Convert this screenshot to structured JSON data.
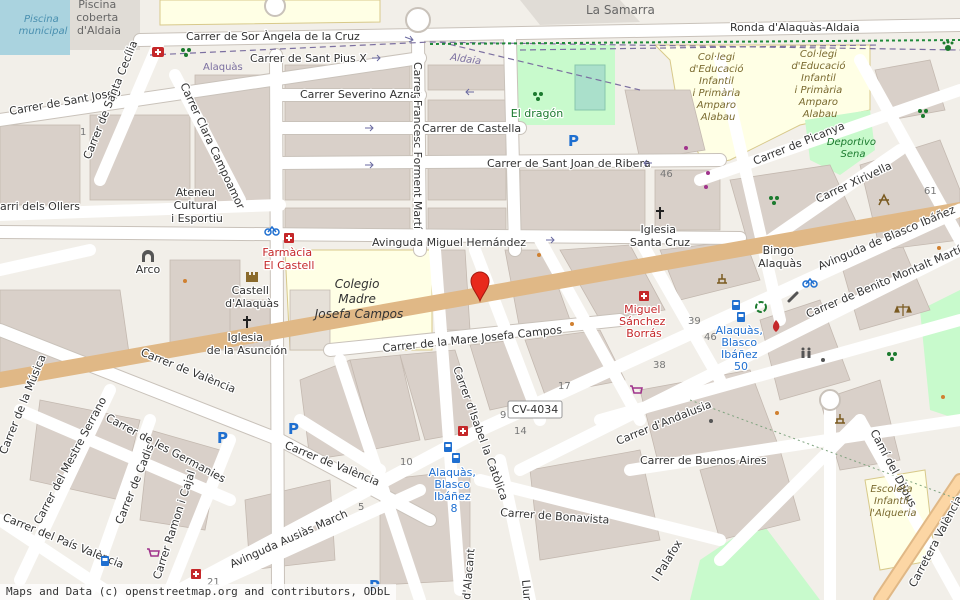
{
  "map": {
    "streets": {
      "sor_angela": "Carrer de Sor Àngela de la Cruz",
      "ronda": "Ronda d'Alaquàs-Aldaia",
      "sant_pius": "Carrer de Sant Pius X",
      "sant_josep": "Carrer de Sant Josep",
      "santa_cecilia": "Carrer de Santa Cecília",
      "clara_campoamor": "Carrer Clara Campoamor",
      "severino": "Carrer Severino Aznar",
      "castella": "Carrer de Castella",
      "francesc": "Carrer Francesc Forment Martí",
      "sant_joan": "Carrer de Sant Joan de Ribera",
      "miguel_hernandez": "Avinguda Miguel Hernández",
      "picanya": "Carrer de Picanya",
      "xirivella": "Carrer Xirivella",
      "blasco": "Avinguda de Blasco Ibáñez",
      "benito": "Carrer de Benito Montalt Martínez",
      "mare_josefa": "Carrer de la Mare Josefa Campos",
      "valencia_1": "Carrer de València",
      "valencia_2": "Carrer de València",
      "isabel": "Carrer d'Isabel la Catòlica",
      "musica": "Carrer de la Música",
      "mestre_serrano": "Carrer del Mestre Serrano",
      "germanies": "Carrer de les Germanies",
      "cadis": "Carrer de Cadis",
      "pais_valencia": "Carrer del País València",
      "ramon": "Carrer Ramon i Cajal",
      "ausias": "Avinguda Ausiàs March",
      "bonavista": "Carrer de Bonavista",
      "andalusia": "Carrer d'Andalusia",
      "buenos_aires": "Carrer de Buenos Aires",
      "cami_dijous": "Camí del Dijous",
      "carretera": "Carretera València",
      "alacant": "d'Alacant",
      "lluna": "Lluna",
      "palafox": "l Palafox",
      "ollers": "arri dels Ollers",
      "la_samarra": "La Samarra",
      "alaquas_small": "Alaquàs",
      "aldaia_small": "Aldaia"
    },
    "road_ref": "CV-4034",
    "places": {
      "piscina_municipal": [
        "Piscina",
        "municipal"
      ],
      "piscina_coberta": [
        "Piscina",
        "coberta",
        "d'Aldaia"
      ],
      "el_dragon": "El dragón",
      "colegio_educacio_1": [
        "Col·legi",
        "d'Educació",
        "Infantil",
        "i Primària",
        "Amparo",
        "Alabau"
      ],
      "colegio_educacio_2": [
        "Col·legi",
        "d'Educació",
        "Infantil",
        "i Primària",
        "Amparo",
        "Alabau"
      ],
      "deportivo_sena": [
        "Deportivo",
        "Sena"
      ],
      "ateneu": [
        "Ateneu",
        "Cultural",
        "i Esportiu"
      ],
      "farmacia_castell": [
        "Farmàcia",
        "El Castell"
      ],
      "colegio_madre": [
        "Colegio",
        "Madre",
        "Josefa Campos"
      ],
      "iglesia_santa_cruz": [
        "Iglesia",
        "Santa Cruz"
      ],
      "bingo": [
        "Bingo",
        "Alaquàs"
      ],
      "arco": "Arco",
      "castell": [
        "Castell",
        "d'Alaquàs"
      ],
      "iglesia_asuncion": [
        "Iglesia",
        "de la Asunción"
      ],
      "miguel_sanchez": [
        "Miguel",
        "Sánchez",
        "Borrás"
      ],
      "bus_50": [
        "Alaquàs,",
        "Blasco",
        "Ibáñez",
        "50"
      ],
      "bus_8": [
        "Alaquàs,",
        "Blasco",
        "Ibáñez",
        "8"
      ],
      "escoleta": [
        "Escoleta",
        "Infantil",
        "l'Alqueria"
      ]
    },
    "house_numbers": [
      "46",
      "61",
      "39",
      "46",
      "38",
      "17",
      "9",
      "14",
      "10",
      "5",
      "1",
      "21"
    ],
    "colors": {
      "background": "#f2efe9",
      "building": "#d9d0c9",
      "road": "#ffffff",
      "road_casing": "#c9c2ba",
      "primary_road": "#fcd6a4",
      "park": "#c8facc",
      "school": "#ffffe5",
      "pitch": "#aae0cb",
      "water": "#aad3df",
      "pharmacy_red": "#c5282a",
      "bus_blue": "#1f6fd0",
      "marker_red": "#e8291c"
    },
    "attribution": "Maps and Data (c) openstreetmap.org and contributors, ODbL"
  }
}
